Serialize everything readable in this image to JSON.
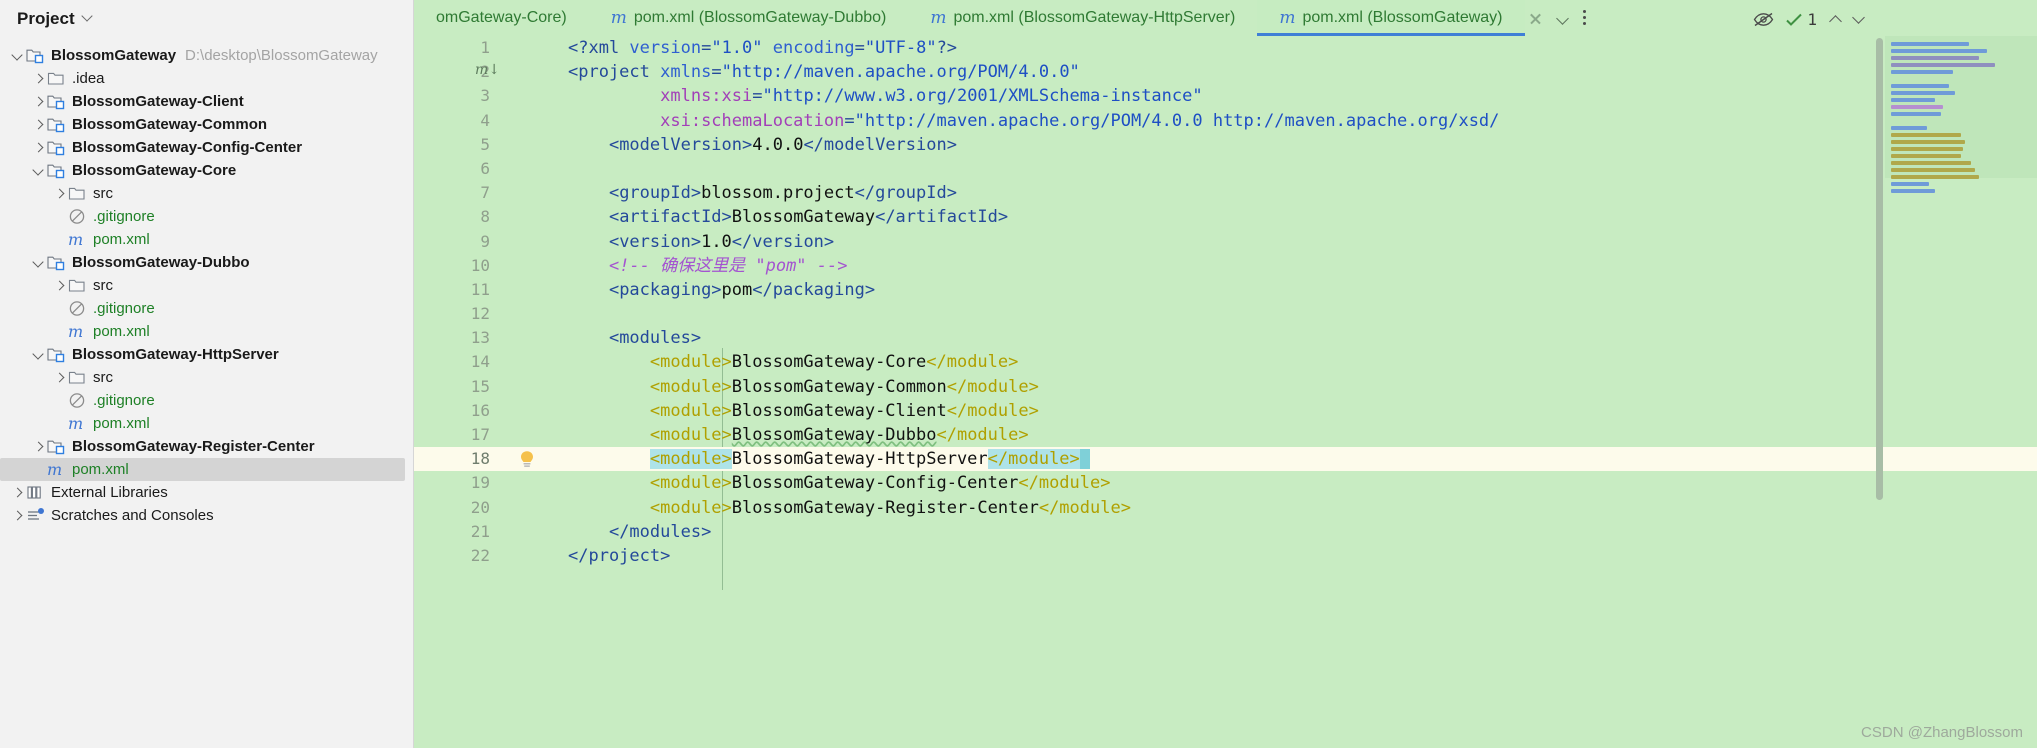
{
  "sidebar": {
    "title": "Project",
    "title_chevron_icon": "chevron-down-icon",
    "items": [
      {
        "label": "BlossomGateway",
        "path": "D:\\desktop\\BlossomGateway",
        "icon": "module-folder-icon",
        "arrow": "down",
        "indent": 0,
        "bold": true,
        "green": false,
        "selected": false
      },
      {
        "label": ".idea",
        "path": "",
        "icon": "folder-icon",
        "arrow": "right",
        "indent": 1,
        "bold": false,
        "green": false,
        "selected": false
      },
      {
        "label": "BlossomGateway-Client",
        "path": "",
        "icon": "module-folder-icon",
        "arrow": "right",
        "indent": 1,
        "bold": true,
        "green": false,
        "selected": false
      },
      {
        "label": "BlossomGateway-Common",
        "path": "",
        "icon": "module-folder-icon",
        "arrow": "right",
        "indent": 1,
        "bold": true,
        "green": false,
        "selected": false
      },
      {
        "label": "BlossomGateway-Config-Center",
        "path": "",
        "icon": "module-folder-icon",
        "arrow": "right",
        "indent": 1,
        "bold": true,
        "green": false,
        "selected": false
      },
      {
        "label": "BlossomGateway-Core",
        "path": "",
        "icon": "module-folder-icon",
        "arrow": "down",
        "indent": 1,
        "bold": true,
        "green": false,
        "selected": false
      },
      {
        "label": "src",
        "path": "",
        "icon": "folder-icon",
        "arrow": "right",
        "indent": 2,
        "bold": false,
        "green": false,
        "selected": false
      },
      {
        "label": ".gitignore",
        "path": "",
        "icon": "gitignore-icon",
        "arrow": "none",
        "indent": 2,
        "bold": false,
        "green": true,
        "selected": false
      },
      {
        "label": "pom.xml",
        "path": "",
        "icon": "maven-icon",
        "arrow": "none",
        "indent": 2,
        "bold": false,
        "green": true,
        "selected": false
      },
      {
        "label": "BlossomGateway-Dubbo",
        "path": "",
        "icon": "module-folder-icon",
        "arrow": "down",
        "indent": 1,
        "bold": true,
        "green": false,
        "selected": false
      },
      {
        "label": "src",
        "path": "",
        "icon": "folder-icon",
        "arrow": "right",
        "indent": 2,
        "bold": false,
        "green": false,
        "selected": false
      },
      {
        "label": ".gitignore",
        "path": "",
        "icon": "gitignore-icon",
        "arrow": "none",
        "indent": 2,
        "bold": false,
        "green": true,
        "selected": false
      },
      {
        "label": "pom.xml",
        "path": "",
        "icon": "maven-icon",
        "arrow": "none",
        "indent": 2,
        "bold": false,
        "green": true,
        "selected": false
      },
      {
        "label": "BlossomGateway-HttpServer",
        "path": "",
        "icon": "module-folder-icon",
        "arrow": "down",
        "indent": 1,
        "bold": true,
        "green": false,
        "selected": false
      },
      {
        "label": "src",
        "path": "",
        "icon": "folder-icon",
        "arrow": "right",
        "indent": 2,
        "bold": false,
        "green": false,
        "selected": false
      },
      {
        "label": ".gitignore",
        "path": "",
        "icon": "gitignore-icon",
        "arrow": "none",
        "indent": 2,
        "bold": false,
        "green": true,
        "selected": false
      },
      {
        "label": "pom.xml",
        "path": "",
        "icon": "maven-icon",
        "arrow": "none",
        "indent": 2,
        "bold": false,
        "green": true,
        "selected": false
      },
      {
        "label": "BlossomGateway-Register-Center",
        "path": "",
        "icon": "module-folder-icon",
        "arrow": "right",
        "indent": 1,
        "bold": true,
        "green": false,
        "selected": false
      },
      {
        "label": "pom.xml",
        "path": "",
        "icon": "maven-icon",
        "arrow": "none",
        "indent": 1,
        "bold": false,
        "green": true,
        "selected": true
      },
      {
        "label": "External Libraries",
        "path": "",
        "icon": "library-icon",
        "arrow": "right",
        "indent": 0,
        "bold": false,
        "green": false,
        "selected": false
      },
      {
        "label": "Scratches and Consoles",
        "path": "",
        "icon": "scratches-icon",
        "arrow": "right",
        "indent": 0,
        "bold": false,
        "green": false,
        "selected": false
      }
    ]
  },
  "tabs": [
    {
      "label": "omGateway-Core)",
      "icon": "",
      "active": false,
      "truncated": true
    },
    {
      "label": "pom.xml (BlossomGateway-Dubbo)",
      "icon": "maven-icon",
      "active": false,
      "truncated": false
    },
    {
      "label": "pom.xml (BlossomGateway-HttpServer)",
      "icon": "maven-icon",
      "active": false,
      "truncated": false
    },
    {
      "label": "pom.xml (BlossomGateway)",
      "icon": "maven-icon",
      "active": true,
      "truncated": false
    }
  ],
  "tab_actions": {
    "close_icon": "close-icon",
    "dropdown_icon": "chevron-down-icon",
    "more_icon": "kebab-menu-icon"
  },
  "inspection_widget": {
    "eye_icon": "eye-off-icon",
    "check_icon": "inspection-ok-icon",
    "count": "1",
    "prev_icon": "chevron-up-icon",
    "next_icon": "chevron-down-icon"
  },
  "gutter": {
    "line_numbers": [
      "1",
      "2",
      "3",
      "4",
      "5",
      "6",
      "7",
      "8",
      "9",
      "10",
      "11",
      "12",
      "13",
      "14",
      "15",
      "16",
      "17",
      "18",
      "19",
      "20",
      "21",
      "22"
    ],
    "maven_marker_line": 2,
    "maven_marker_icon": "maven-download-icon",
    "bulb_line": 18,
    "bulb_icon": "lightbulb-hint-icon"
  },
  "code": {
    "current_line": 18,
    "lines": [
      {
        "n": 1,
        "tokens": [
          {
            "t": "<?xml ",
            "c": "punct"
          },
          {
            "t": "version",
            "c": "attr"
          },
          {
            "t": "=",
            "c": "punct"
          },
          {
            "t": "\"1.0\"",
            "c": "str"
          },
          {
            "t": " ",
            "c": "txt"
          },
          {
            "t": "encoding",
            "c": "attr"
          },
          {
            "t": "=",
            "c": "punct"
          },
          {
            "t": "\"UTF-8\"",
            "c": "str"
          },
          {
            "t": "?>",
            "c": "punct"
          }
        ]
      },
      {
        "n": 2,
        "tokens": [
          {
            "t": "<project ",
            "c": "tag"
          },
          {
            "t": "xmlns",
            "c": "attr"
          },
          {
            "t": "=",
            "c": "punct"
          },
          {
            "t": "\"http://maven.apache.org/POM/4.0.0\"",
            "c": "str"
          }
        ]
      },
      {
        "n": 3,
        "tokens": [
          {
            "t": "         ",
            "c": "txt"
          },
          {
            "t": "xmlns:xsi",
            "c": "attr2"
          },
          {
            "t": "=",
            "c": "punct"
          },
          {
            "t": "\"http://www.w3.org/2001/XMLSchema-instance\"",
            "c": "str"
          }
        ]
      },
      {
        "n": 4,
        "tokens": [
          {
            "t": "         ",
            "c": "txt"
          },
          {
            "t": "xsi:schemaLocation",
            "c": "attr2"
          },
          {
            "t": "=",
            "c": "punct"
          },
          {
            "t": "\"http://maven.apache.org/POM/4.0.0 http://maven.apache.org/xsd/",
            "c": "str"
          }
        ]
      },
      {
        "n": 5,
        "tokens": [
          {
            "t": "    ",
            "c": "txt"
          },
          {
            "t": "<modelVersion>",
            "c": "tag"
          },
          {
            "t": "4.0.0",
            "c": "txt"
          },
          {
            "t": "</modelVersion>",
            "c": "tag"
          }
        ]
      },
      {
        "n": 6,
        "tokens": []
      },
      {
        "n": 7,
        "tokens": [
          {
            "t": "    ",
            "c": "txt"
          },
          {
            "t": "<groupId>",
            "c": "tag"
          },
          {
            "t": "blossom.project",
            "c": "txt"
          },
          {
            "t": "</groupId>",
            "c": "tag"
          }
        ]
      },
      {
        "n": 8,
        "tokens": [
          {
            "t": "    ",
            "c": "txt"
          },
          {
            "t": "<artifactId>",
            "c": "tag"
          },
          {
            "t": "BlossomGateway",
            "c": "txt"
          },
          {
            "t": "</artifactId>",
            "c": "tag"
          }
        ]
      },
      {
        "n": 9,
        "tokens": [
          {
            "t": "    ",
            "c": "txt"
          },
          {
            "t": "<version>",
            "c": "tag"
          },
          {
            "t": "1.0",
            "c": "txt"
          },
          {
            "t": "</version>",
            "c": "tag"
          }
        ]
      },
      {
        "n": 10,
        "tokens": [
          {
            "t": "    ",
            "c": "txt"
          },
          {
            "t": "<!-- 确保这里是 \"pom\" -->",
            "c": "com"
          }
        ]
      },
      {
        "n": 11,
        "tokens": [
          {
            "t": "    ",
            "c": "txt"
          },
          {
            "t": "<packaging>",
            "c": "tag"
          },
          {
            "t": "pom",
            "c": "txt"
          },
          {
            "t": "</packaging>",
            "c": "tag"
          }
        ]
      },
      {
        "n": 12,
        "tokens": []
      },
      {
        "n": 13,
        "tokens": [
          {
            "t": "    ",
            "c": "txt"
          },
          {
            "t": "<modules>",
            "c": "tag"
          }
        ]
      },
      {
        "n": 14,
        "tokens": [
          {
            "t": "        ",
            "c": "txt"
          },
          {
            "t": "<module>",
            "c": "tag2"
          },
          {
            "t": "BlossomGateway-Core",
            "c": "txt"
          },
          {
            "t": "</module>",
            "c": "tag2"
          }
        ]
      },
      {
        "n": 15,
        "tokens": [
          {
            "t": "        ",
            "c": "txt"
          },
          {
            "t": "<module>",
            "c": "tag2"
          },
          {
            "t": "BlossomGateway-Common",
            "c": "txt"
          },
          {
            "t": "</module>",
            "c": "tag2"
          }
        ]
      },
      {
        "n": 16,
        "tokens": [
          {
            "t": "        ",
            "c": "txt"
          },
          {
            "t": "<module>",
            "c": "tag2"
          },
          {
            "t": "BlossomGateway-Client",
            "c": "txt"
          },
          {
            "t": "</module>",
            "c": "tag2"
          }
        ]
      },
      {
        "n": 17,
        "tokens": [
          {
            "t": "        ",
            "c": "txt"
          },
          {
            "t": "<module>",
            "c": "tag2"
          },
          {
            "t": "BlossomGateway-Dubbo",
            "c": "wavy"
          },
          {
            "t": "</module>",
            "c": "tag2"
          }
        ]
      },
      {
        "n": 18,
        "tokens": [
          {
            "t": "        ",
            "c": "txt"
          },
          {
            "t": "<module>",
            "c": "tag2 sel"
          },
          {
            "t": "BlossomGateway-HttpServer",
            "c": "txt"
          },
          {
            "t": "</module>",
            "c": "tag2 sel"
          },
          {
            "t": " ",
            "c": "selcaret"
          }
        ]
      },
      {
        "n": 19,
        "tokens": [
          {
            "t": "        ",
            "c": "txt"
          },
          {
            "t": "<module>",
            "c": "tag2"
          },
          {
            "t": "BlossomGateway-Config-Center",
            "c": "txt"
          },
          {
            "t": "</module>",
            "c": "tag2"
          }
        ]
      },
      {
        "n": 20,
        "tokens": [
          {
            "t": "        ",
            "c": "txt"
          },
          {
            "t": "<module>",
            "c": "tag2"
          },
          {
            "t": "BlossomGateway-Register-Center",
            "c": "txt"
          },
          {
            "t": "</module>",
            "c": "tag2"
          }
        ]
      },
      {
        "n": 21,
        "tokens": [
          {
            "t": "    ",
            "c": "txt"
          },
          {
            "t": "</modules>",
            "c": "tag"
          }
        ]
      },
      {
        "n": 22,
        "tokens": [
          {
            "t": "</project>",
            "c": "tag"
          }
        ]
      }
    ]
  },
  "watermark": "CSDN @ZhangBlossom",
  "colors": {
    "editor_bg": "#c8ecc2",
    "caret_line_bg": "#fdfbeb",
    "sidebar_bg": "#f2f2f2",
    "selection": "#aee3e8",
    "tab_active_underline": "#3f7fd6",
    "vcs_green": "#1e8026",
    "tag_blue": "#24499a",
    "tag_yellow": "#b0a000",
    "string_blue": "#1e4fc4",
    "comment_purple": "#a454d0"
  }
}
